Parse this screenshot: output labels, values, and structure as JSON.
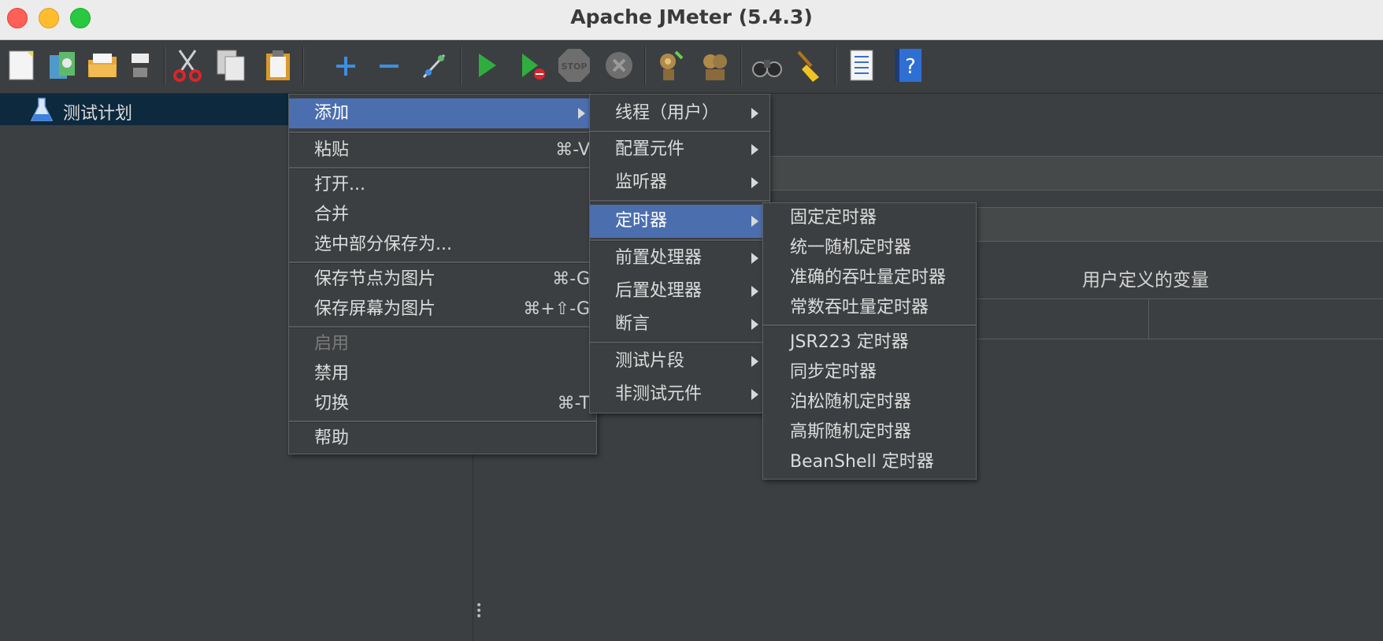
{
  "window": {
    "title": "Apache JMeter (5.4.3)"
  },
  "toolbar": {
    "buttons": [
      {
        "name": "new-icon"
      },
      {
        "name": "templates-icon"
      },
      {
        "name": "open-icon"
      },
      {
        "name": "save-icon"
      },
      {
        "name": "cut-icon"
      },
      {
        "name": "copy-icon"
      },
      {
        "name": "paste-icon"
      },
      {
        "name": "expand-icon"
      },
      {
        "name": "collapse-icon"
      },
      {
        "name": "toggle-icon"
      },
      {
        "name": "start-icon"
      },
      {
        "name": "start-no-pause-icon"
      },
      {
        "name": "stop-icon"
      },
      {
        "name": "shutdown-icon"
      },
      {
        "name": "clear-icon"
      },
      {
        "name": "clear-all-icon"
      },
      {
        "name": "search-icon"
      },
      {
        "name": "reset-search-icon"
      },
      {
        "name": "function-helper-icon"
      },
      {
        "name": "help-icon"
      }
    ]
  },
  "tree": {
    "selected_item": "测试计划",
    "icon": "flask-icon"
  },
  "right_panel": {
    "user_vars_label": "用户定义的变量"
  },
  "context_menu": {
    "items": [
      {
        "label": "添加",
        "shortcut": "",
        "submenu": true
      },
      {
        "label": "粘贴",
        "shortcut": "⌘-V"
      },
      {
        "label": "打开...",
        "shortcut": ""
      },
      {
        "label": "合并",
        "shortcut": ""
      },
      {
        "label": "选中部分保存为...",
        "shortcut": ""
      },
      {
        "label": "保存节点为图片",
        "shortcut": "⌘-G"
      },
      {
        "label": "保存屏幕为图片",
        "shortcut": "⌘+⇧-G"
      },
      {
        "label": "启用",
        "shortcut": "",
        "disabled": true
      },
      {
        "label": "禁用",
        "shortcut": ""
      },
      {
        "label": "切换",
        "shortcut": "⌘-T"
      },
      {
        "label": "帮助",
        "shortcut": ""
      }
    ]
  },
  "add_submenu": {
    "items": [
      {
        "label": "线程（用户）"
      },
      {
        "label": "配置元件"
      },
      {
        "label": "监听器"
      },
      {
        "label": "定时器"
      },
      {
        "label": "前置处理器"
      },
      {
        "label": "后置处理器"
      },
      {
        "label": "断言"
      },
      {
        "label": "测试片段"
      },
      {
        "label": "非测试元件"
      }
    ]
  },
  "timer_submenu": {
    "items": [
      {
        "label": "固定定时器"
      },
      {
        "label": "统一随机定时器"
      },
      {
        "label": "准确的吞吐量定时器"
      },
      {
        "label": "常数吞吐量定时器"
      },
      {
        "label": "JSR223 定时器"
      },
      {
        "label": "同步定时器"
      },
      {
        "label": "泊松随机定时器"
      },
      {
        "label": "高斯随机定时器"
      },
      {
        "label": "BeanShell 定时器"
      }
    ]
  },
  "colors": {
    "menu_highlight": "#4b6eaf",
    "tree_selection": "#0d293e",
    "background": "#3c3f41"
  }
}
